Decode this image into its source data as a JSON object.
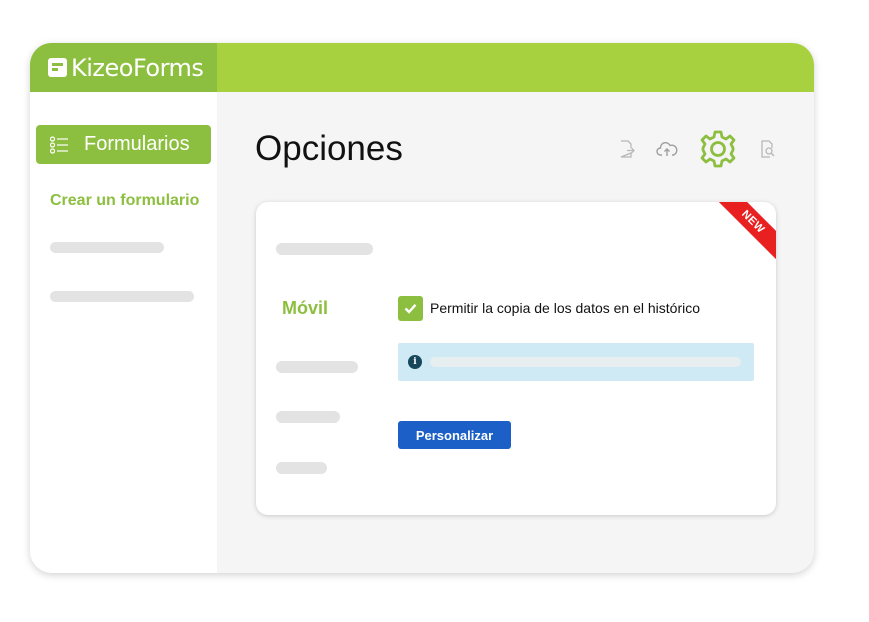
{
  "app": {
    "logo_text": "KizeoForms",
    "brand_color": "#8cbf3f",
    "topbar_color": "#a8d13f"
  },
  "sidebar": {
    "active_item": {
      "label": "Formularios",
      "icon": "list-icon"
    },
    "link": {
      "label": "Crear un formulario"
    }
  },
  "page": {
    "title": "Opciones"
  },
  "toolbar": {
    "icons": [
      "export-icon",
      "cloud-upload-icon",
      "gear-icon",
      "document-search-icon"
    ],
    "active_icon": "gear-icon"
  },
  "card": {
    "ribbon": "NEW",
    "section_label": "Móvil",
    "checkbox": {
      "label": "Permitir la copia de los datos en el histórico",
      "checked": true
    },
    "info_icon": "i",
    "button": {
      "label": "Personalizar",
      "color": "#1b5fc7"
    }
  }
}
